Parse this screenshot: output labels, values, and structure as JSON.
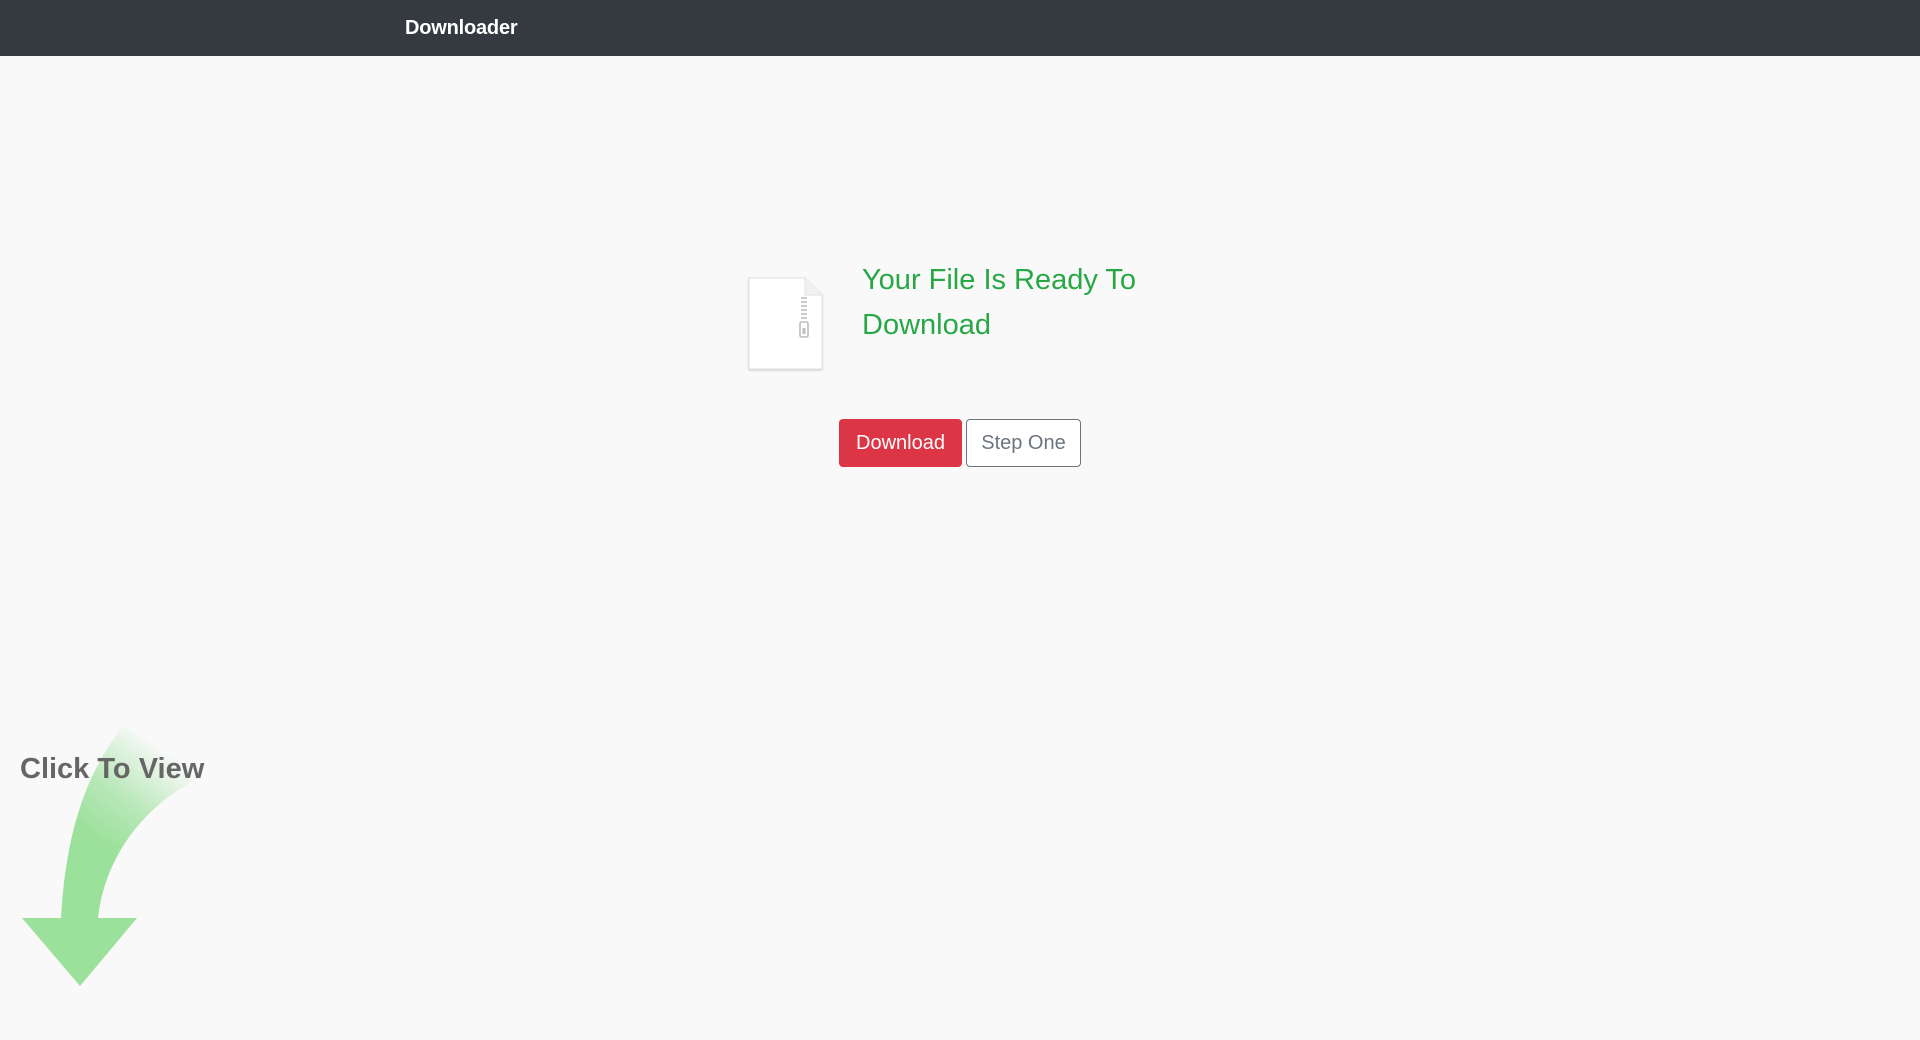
{
  "navbar": {
    "brand": "Downloader",
    "background_color": "#343a40"
  },
  "file": {
    "icon": "zip-file-icon",
    "headline": "Your File Is Ready To Download",
    "headline_color": "#28a745"
  },
  "buttons": {
    "download_label": "Download",
    "download_color": "#dc3545",
    "step_label": "Step One",
    "step_color": "#6c757d"
  },
  "promo": {
    "label": "Click To View",
    "arrow_icon": "curved-arrow-down-icon",
    "arrow_color": "#9be09b"
  }
}
